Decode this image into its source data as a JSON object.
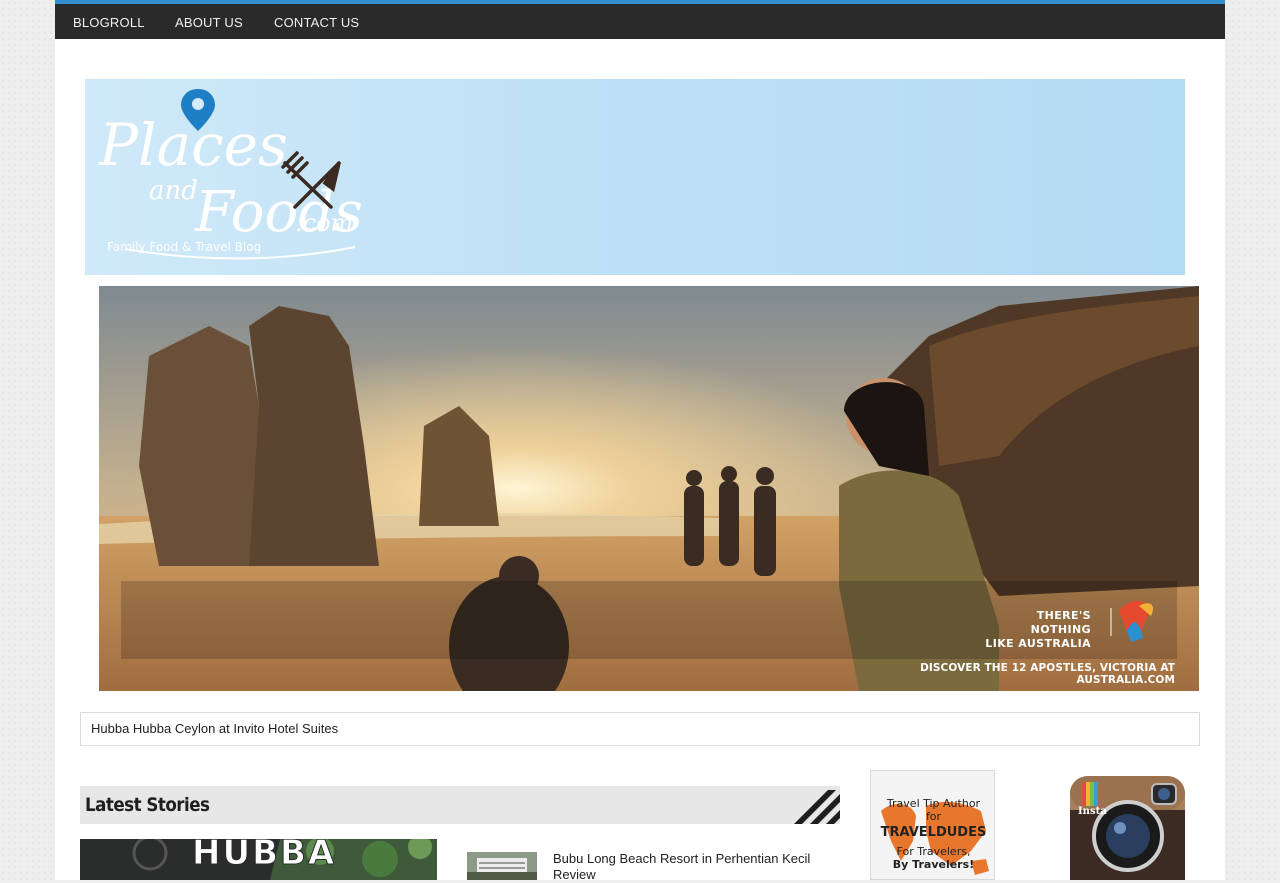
{
  "nav": {
    "items": [
      {
        "label": "BLOGROLL"
      },
      {
        "label": "ABOUT US"
      },
      {
        "label": "CONTACT US"
      }
    ]
  },
  "header": {
    "logo_line1": "Places",
    "logo_line2": "and",
    "logo_line3": "Foods",
    "logo_domain": ".com",
    "logo_tagline": "Family Food & Travel Blog"
  },
  "ad": {
    "tagline_line1": "THERE'S NOTHING",
    "tagline_line2": "LIKE AUSTRALIA",
    "cta": "DISCOVER THE 12 APOSTLES, VICTORIA AT AUSTRALIA.COM"
  },
  "ticker": {
    "text": "Hubba Hubba Ceylon at Invito Hotel Suites"
  },
  "latest": {
    "title": "Latest Stories",
    "featured_sign": "HUBBA",
    "stories": [
      {
        "title": "Bubu Long Beach Resort in Perhentian Kecil Review"
      }
    ]
  },
  "sidebar": {
    "travel_line1": "Travel Tip Author",
    "travel_line2": "for",
    "travel_brand": "TRAVELDUDES",
    "travel_line3": "For Travelers,",
    "travel_line4": "By Travelers!",
    "insta_label": "Insta"
  },
  "colors": {
    "nav_bg": "#2a2a2a",
    "nav_accent": "#2e8ecf",
    "section_bg": "#e7e7e7"
  }
}
